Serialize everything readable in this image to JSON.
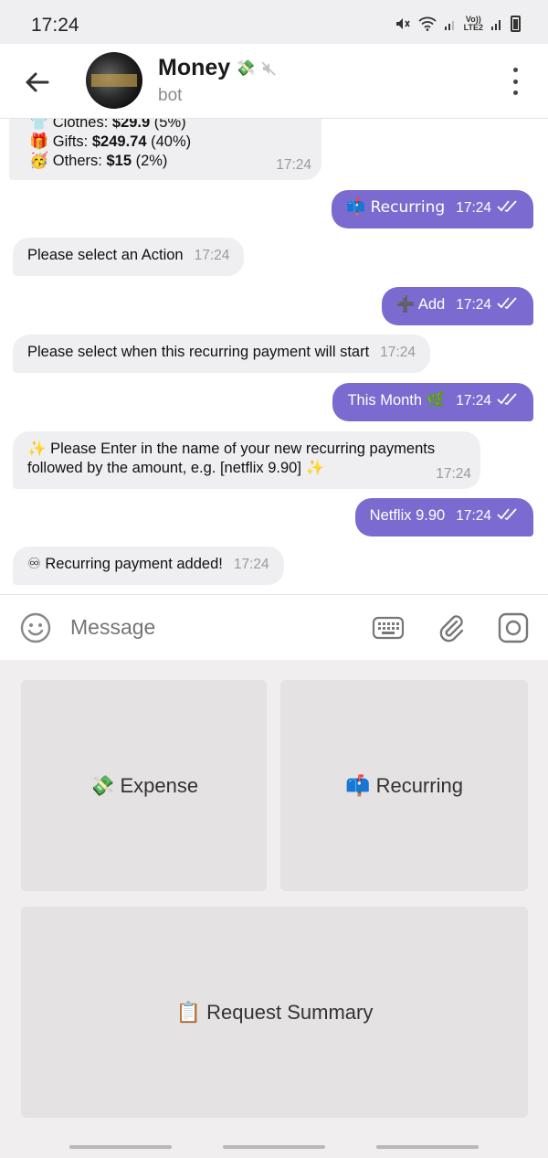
{
  "status_bar": {
    "time": "17:24",
    "network": "LTE2",
    "volte": "Vo))"
  },
  "header": {
    "title": "Money",
    "title_emoji": "💸",
    "subtitle": "bot"
  },
  "messages": {
    "summary": {
      "clothes_label": "Clothes:",
      "clothes_amount": "$29.9",
      "clothes_pct": "(5%)",
      "gifts_label": "Gifts:",
      "gifts_amount": "$249.74",
      "gifts_pct": "(40%)",
      "others_label": "Others:",
      "others_amount": "$15",
      "others_pct": "(2%)",
      "time": "17:24"
    },
    "m1": {
      "text": "📫 Recurring",
      "time": "17:24"
    },
    "m2": {
      "text": "Please select an Action",
      "time": "17:24"
    },
    "m3": {
      "text": "➕ Add",
      "time": "17:24"
    },
    "m4": {
      "text": "Please select when this recurring payment will start",
      "time": "17:24"
    },
    "m5": {
      "text": "This Month 🌿",
      "time": "17:24"
    },
    "m6": {
      "line1": "✨ Please Enter in the name of your new recurring payments",
      "line2": "followed by the amount, e.g. [netflix 9.90] ✨",
      "time": "17:24"
    },
    "m7": {
      "text": "Netflix 9.90",
      "time": "17:24"
    },
    "m8": {
      "text": "♾ Recurring payment added!",
      "time": "17:24"
    }
  },
  "composer": {
    "placeholder": "Message"
  },
  "keyboard": {
    "expense": "💸 Expense",
    "recurring": "📫 Recurring",
    "summary": "📋 Request Summary"
  },
  "colors": {
    "accent": "#7b6ad0",
    "incoming": "#efeff1",
    "keyboard_bg": "#f0eeee"
  }
}
